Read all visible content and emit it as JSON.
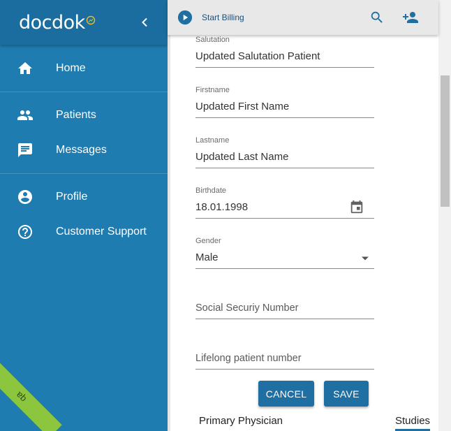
{
  "app": {
    "brand": "docdok",
    "environment_badge": "qa"
  },
  "sidebar": {
    "items": [
      {
        "label": "Home",
        "icon": "home-icon"
      },
      {
        "label": "Patients",
        "icon": "people-icon"
      },
      {
        "label": "Messages",
        "icon": "message-icon"
      },
      {
        "label": "Profile",
        "icon": "account-circle-icon"
      },
      {
        "label": "Customer Support",
        "icon": "help-circle-icon"
      }
    ]
  },
  "topbar": {
    "billing_label": "Start Billing"
  },
  "form": {
    "salutation": {
      "label": "Salutation",
      "value": "Updated Salutation Patient"
    },
    "firstname": {
      "label": "Firstname",
      "value": "Updated First Name"
    },
    "lastname": {
      "label": "Lastname",
      "value": "Updated Last Name"
    },
    "birthdate": {
      "label": "Birthdate",
      "value": "18.01.1998"
    },
    "gender": {
      "label": "Gender",
      "value": "Male"
    },
    "social_security": {
      "placeholder": "Social Securiy Number"
    },
    "lifelong_number": {
      "placeholder": "Lifelong patient number"
    },
    "cancel_label": "CANCEL",
    "save_label": "SAVE"
  },
  "below": {
    "primary_physician_title": "Primary Physician",
    "studies_tab": "Studies"
  },
  "colors": {
    "sidebar": "#1e7cb0",
    "sidebar_header": "#1a6d9e",
    "accent": "#1f6fa3",
    "badge": "#8cc63f"
  }
}
